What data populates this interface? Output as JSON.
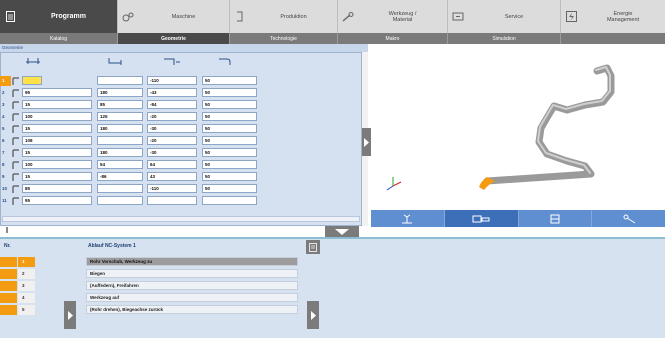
{
  "topnav": [
    {
      "label": "Programm",
      "icon": "document-icon",
      "active": true
    },
    {
      "label": "Maschine",
      "icon": "gears-icon",
      "active": false
    },
    {
      "label": "Produktion",
      "icon": "bracket-icon",
      "active": false
    },
    {
      "label": "Werkzeug /\nMaterial",
      "icon": "wrench-icon",
      "active": false
    },
    {
      "label": "Service",
      "icon": "service-icon",
      "active": false
    },
    {
      "label": "Energie\nManagement",
      "icon": "energy-icon",
      "active": false
    }
  ],
  "subtabs": [
    {
      "label": "Katalog",
      "active": false
    },
    {
      "label": "Geometrie",
      "active": true
    },
    {
      "label": "Technologie",
      "active": false
    },
    {
      "label": "Makro",
      "active": false
    },
    {
      "label": "Simulation",
      "active": false
    },
    {
      "label": "",
      "active": false
    }
  ],
  "geometry": {
    "title": "Geometrie",
    "columns": [
      "distance-icon",
      "bend-icon",
      "rotation-icon",
      "radius-icon"
    ],
    "rows": [
      {
        "n": "1",
        "c1": "",
        "c2": "",
        "c3": "-110",
        "c4": "50",
        "active": true
      },
      {
        "n": "2",
        "c1": "95",
        "c2": "180",
        "c3": "-43",
        "c4": "50",
        "active": false
      },
      {
        "n": "3",
        "c1": "15",
        "c2": "85",
        "c3": "-84",
        "c4": "50",
        "active": false
      },
      {
        "n": "4",
        "c1": "100",
        "c2": "125",
        "c3": "-20",
        "c4": "50",
        "active": false
      },
      {
        "n": "5",
        "c1": "15",
        "c2": "180",
        "c3": "-30",
        "c4": "50",
        "active": false
      },
      {
        "n": "6",
        "c1": "108",
        "c2": "",
        "c3": "-20",
        "c4": "50",
        "active": false
      },
      {
        "n": "7",
        "c1": "15",
        "c2": "180",
        "c3": "-30",
        "c4": "50",
        "active": false
      },
      {
        "n": "8",
        "c1": "100",
        "c2": "54",
        "c3": "64",
        "c4": "50",
        "active": false
      },
      {
        "n": "9",
        "c1": "15",
        "c2": "-86",
        "c3": "43",
        "c4": "50",
        "active": false
      },
      {
        "n": "10",
        "c1": "85",
        "c2": "",
        "c3": "-110",
        "c4": "50",
        "active": false
      },
      {
        "n": "11",
        "c1": "95",
        "c2": "",
        "c3": "",
        "c4": "",
        "active": false
      }
    ]
  },
  "viewer": {
    "toolbar": [
      "bend-machine-icon",
      "camera-icon",
      "layers-icon",
      "tool-icon"
    ],
    "tube_color": "#9a9a9a",
    "tube_end_color": "#f39c12"
  },
  "sequence": {
    "col_nr": "Nr.",
    "col_title": "Ablauf  NC-System 1",
    "rows": [
      {
        "n": "1",
        "text": "Rohr Vorschub, Werkzeug zu",
        "active": true
      },
      {
        "n": "2",
        "text": "Biegen",
        "active": false
      },
      {
        "n": "3",
        "text": "(Auffedern), Freifahren",
        "active": false
      },
      {
        "n": "4",
        "text": "Werkzeug auf",
        "active": false
      },
      {
        "n": "5",
        "text": "(Rohr drehen), Biegeachse zurück",
        "active": false
      }
    ]
  },
  "colors": {
    "accent": "#f39c12",
    "panel": "#d5e1f0",
    "viewer_bar": "#5f8fd0"
  }
}
